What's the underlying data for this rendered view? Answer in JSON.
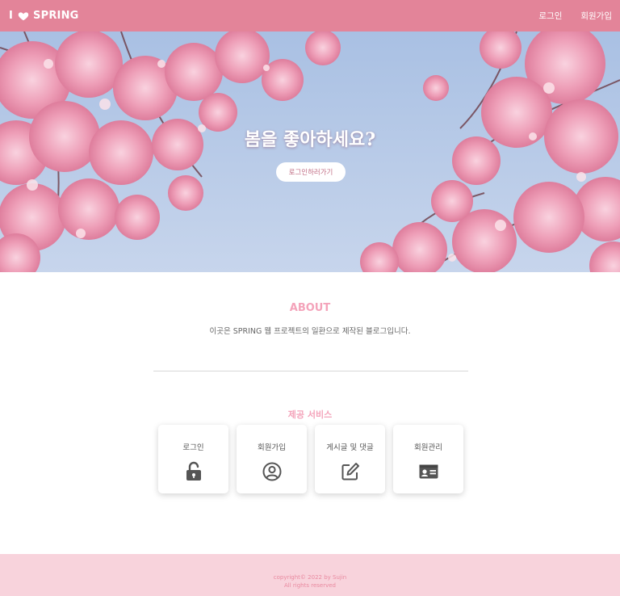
{
  "navbar": {
    "brand_prefix": "I",
    "brand_name": "SPRING",
    "links": [
      "로그인",
      "회원가입"
    ]
  },
  "hero": {
    "title": "봄을 좋아하세요?",
    "cta_label": "로그인하러가기"
  },
  "about": {
    "title": "ABOUT",
    "description": "이곳은 SPRING 웹 프로젝트의 일환으로 제작된 블로그입니다."
  },
  "services": {
    "title": "제공 서비스",
    "items": [
      {
        "label": "로그인",
        "icon": "unlock-icon"
      },
      {
        "label": "회원가입",
        "icon": "user-circle-icon"
      },
      {
        "label": "게시글 및 댓글",
        "icon": "edit-icon"
      },
      {
        "label": "회원관리",
        "icon": "id-card-icon"
      }
    ]
  },
  "footer": {
    "line1": "copyright© 2022 by Sujin",
    "line2": "All rights reserved"
  },
  "colors": {
    "navbar": "#e38499",
    "accent": "#f4a3ba",
    "footer_bg": "#f8d3dc",
    "sky": "#b9cbe6",
    "blossom": "#f0a9bf"
  }
}
